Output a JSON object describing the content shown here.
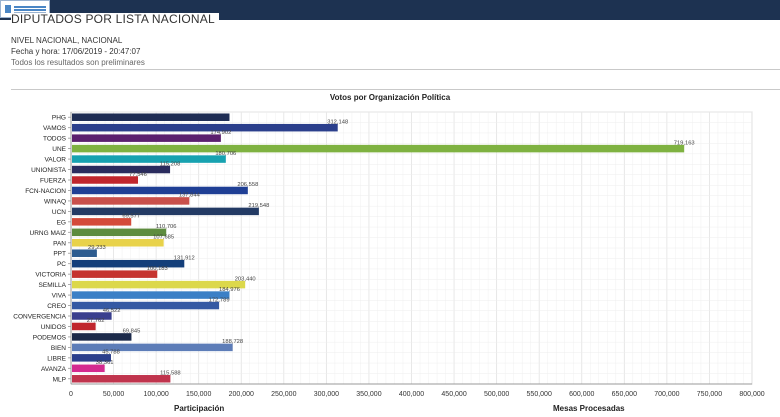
{
  "header": {
    "title": "DIPUTADOS POR LISTA NACIONAL",
    "scope": "NIVEL NACIONAL, NACIONAL",
    "datetime": "Fecha y hora: 17/06/2019 - 20:47:07",
    "note": "Todos los resultados son preliminares"
  },
  "chart_data": {
    "type": "bar",
    "orientation": "horizontal",
    "title": "Votos por Organización Política",
    "categories": [
      "PHG",
      "VAMOS",
      "TODOS",
      "UNE",
      "VALOR",
      "UNIONISTA",
      "FUERZA",
      "FCN-NACION",
      "WINAQ",
      "UCN",
      "EG",
      "URNG MAIZ",
      "PAN",
      "PPT",
      "PC",
      "VICTORIA",
      "SEMILLA",
      "VIVA",
      "CREO",
      "CONVERGENCIA",
      "UNIDOS",
      "PODEMOS",
      "BIEN",
      "LIBRE",
      "AVANZA",
      "MLP"
    ],
    "values": [
      185000,
      312148,
      174902,
      719163,
      180706,
      115208,
      77546,
      206558,
      137844,
      219548,
      69577,
      110706,
      107685,
      29233,
      131912,
      100183,
      203440,
      184976,
      172789,
      46522,
      27762,
      69845,
      188728,
      45788,
      38361,
      115588
    ],
    "labels": [
      "",
      "312,148",
      "174,902",
      "719,163",
      "180,706",
      "115,208",
      "77,546",
      "206,558",
      "137,844",
      "219,548",
      "69,577",
      "110,706",
      "107,685",
      "29,233",
      "131,912",
      "100,183",
      "203,440",
      "184,976",
      "172,789",
      "46,522",
      "27,762",
      "69,845",
      "188,728",
      "45,788",
      "38,361",
      "115,588"
    ],
    "colors": [
      "#1f2d54",
      "#2b3f8c",
      "#5b1f6e",
      "#7fb241",
      "#17a2b0",
      "#2a2c5e",
      "#c0262d",
      "#1f3f95",
      "#c9504b",
      "#233a64",
      "#d44a3a",
      "#5e8c3f",
      "#e8d24a",
      "#2d5c8f",
      "#143f7a",
      "#c5342f",
      "#dcd84a",
      "#3b80c6",
      "#3559a3",
      "#3a3f8e",
      "#c0262d",
      "#1c2a4a",
      "#5d7db8",
      "#2b3f8c",
      "#d42a8f",
      "#c0344d"
    ],
    "x_ticks": [
      "0",
      "50,000",
      "100,000",
      "150,000",
      "200,000",
      "250,000",
      "300,000",
      "350,000",
      "400,000",
      "450,000",
      "500,000",
      "550,000",
      "600,000",
      "650,000",
      "700,000",
      "750,000",
      "800,000"
    ],
    "xlim": [
      0,
      800000
    ],
    "grid": true
  },
  "footer": {
    "left_label": "Participación",
    "right_label": "Mesas Procesadas"
  }
}
